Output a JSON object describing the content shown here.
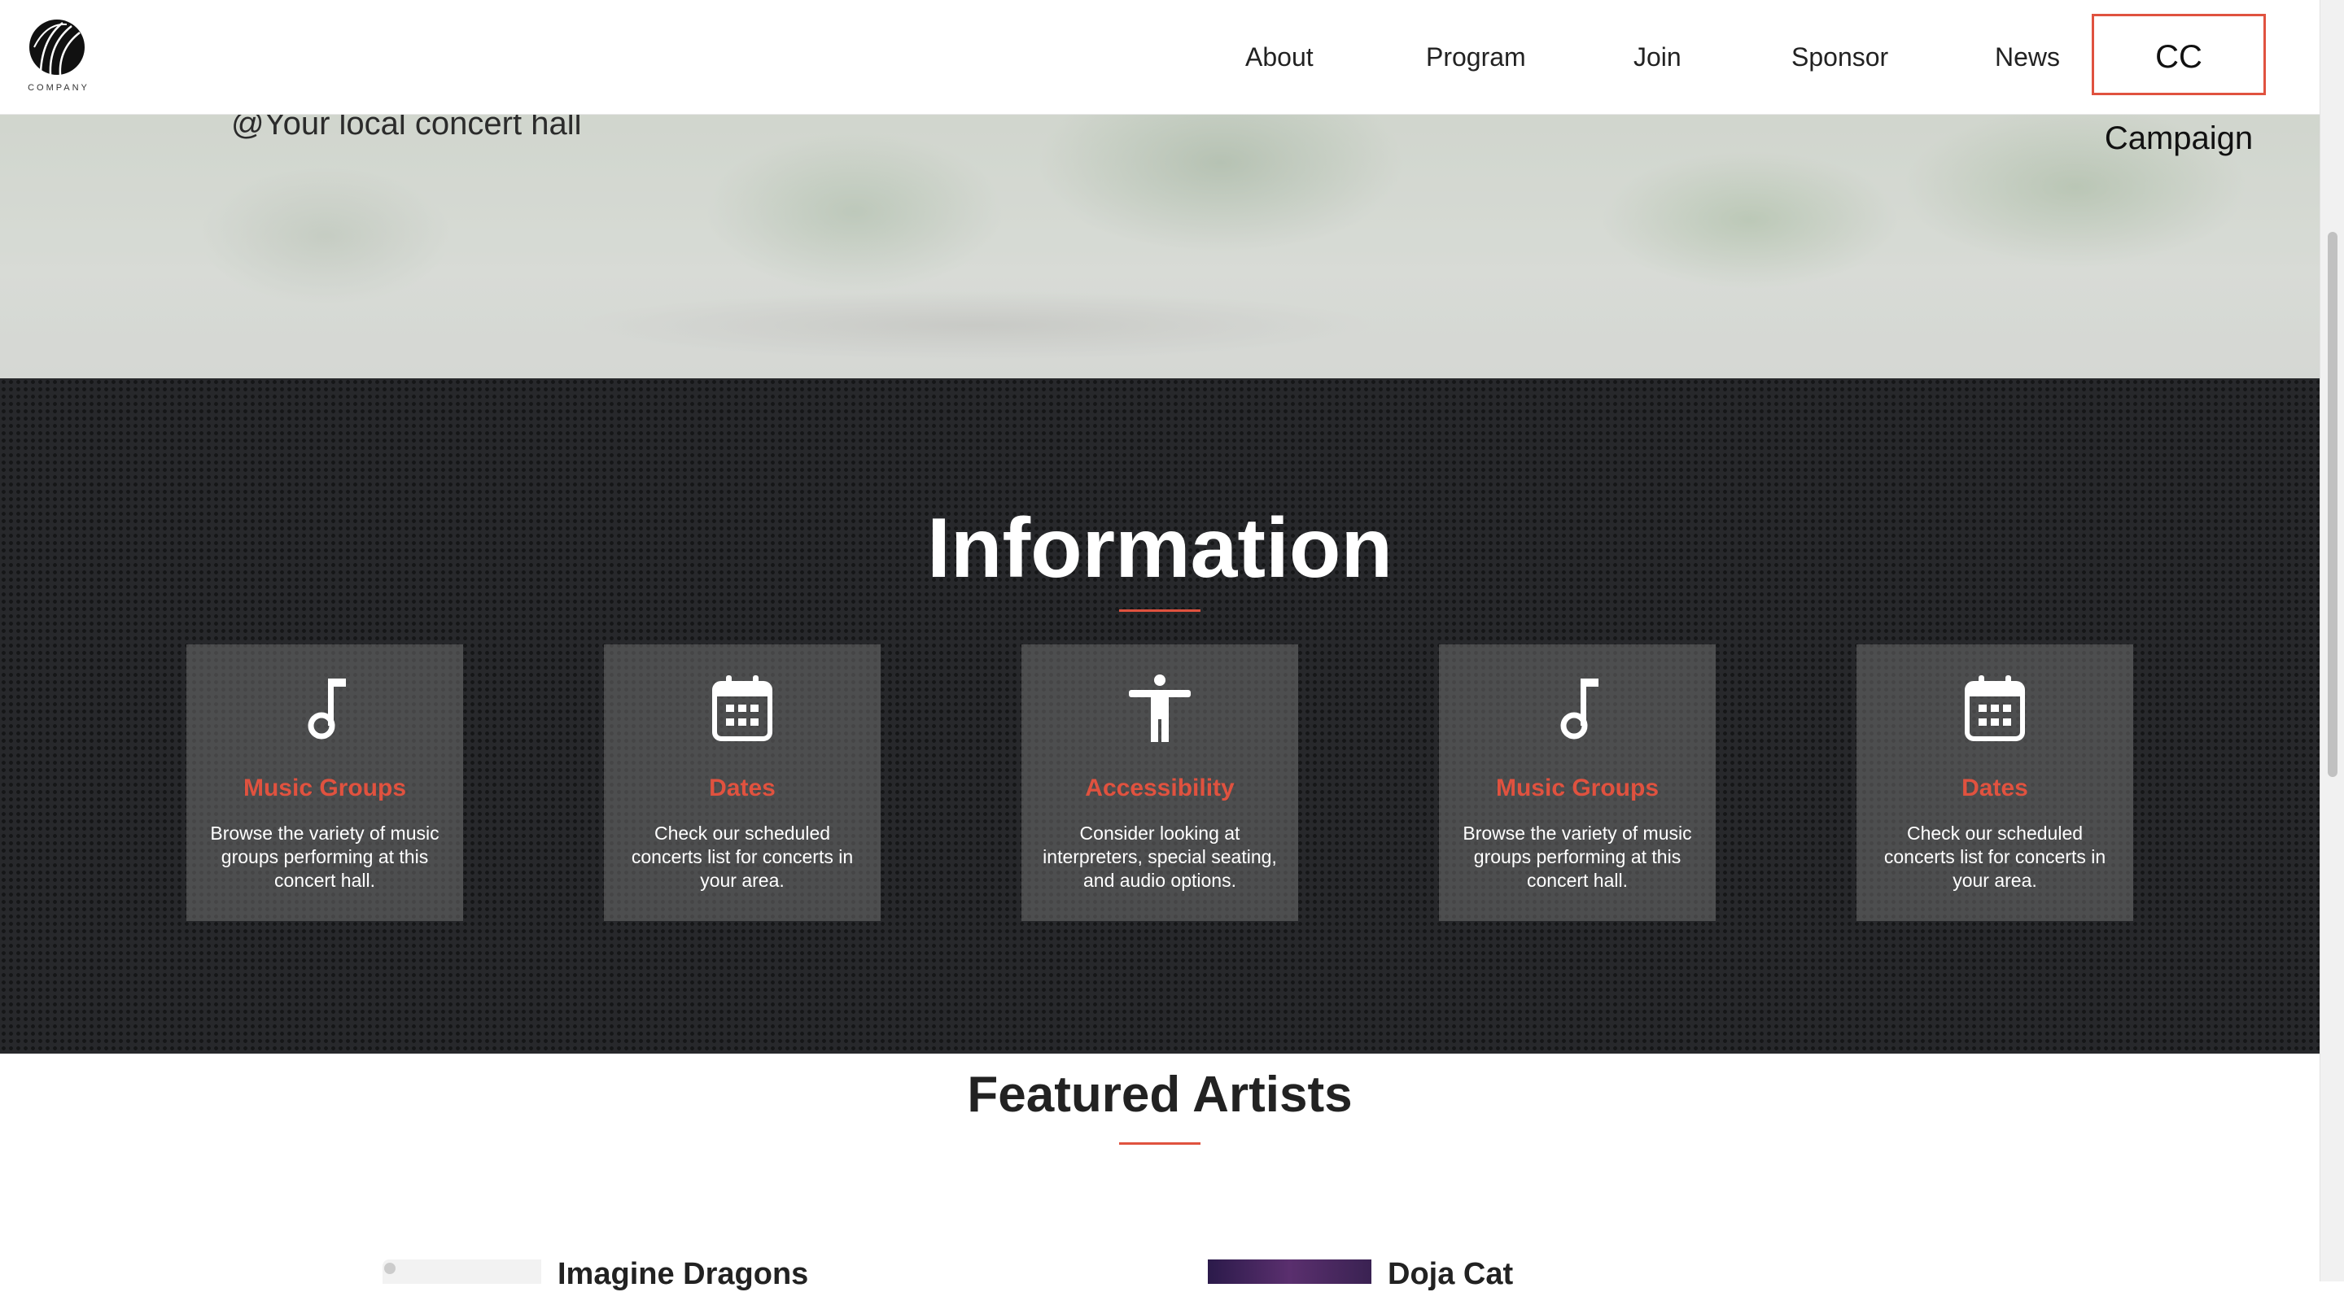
{
  "brand": {
    "logo_text": "COMPANY"
  },
  "nav": {
    "items": [
      "About",
      "Program",
      "Join",
      "Sponsor",
      "News"
    ],
    "cta": "CC Campaign"
  },
  "hero": {
    "location": "@Your local concert hall"
  },
  "information": {
    "title": "Information",
    "cards": [
      {
        "icon": "music-note-icon",
        "title": "Music Groups",
        "desc": "Browse the variety of music groups performing at this concert hall."
      },
      {
        "icon": "calendar-icon",
        "title": "Dates",
        "desc": "Check our scheduled concerts list for concerts in your area."
      },
      {
        "icon": "accessibility-icon",
        "title": "Accessibility",
        "desc": "Consider looking at interpreters, special seating, and audio options."
      },
      {
        "icon": "music-note-icon",
        "title": "Music Groups",
        "desc": "Browse the variety of music groups performing at this concert hall."
      },
      {
        "icon": "calendar-icon",
        "title": "Dates",
        "desc": "Check our scheduled concerts list for concerts in your area."
      }
    ]
  },
  "featured": {
    "title": "Featured Artists",
    "artists": [
      "Imagine Dragons",
      "Doja Cat"
    ]
  },
  "colors": {
    "accent": "#e0523f",
    "dark_section": "#27282b"
  }
}
